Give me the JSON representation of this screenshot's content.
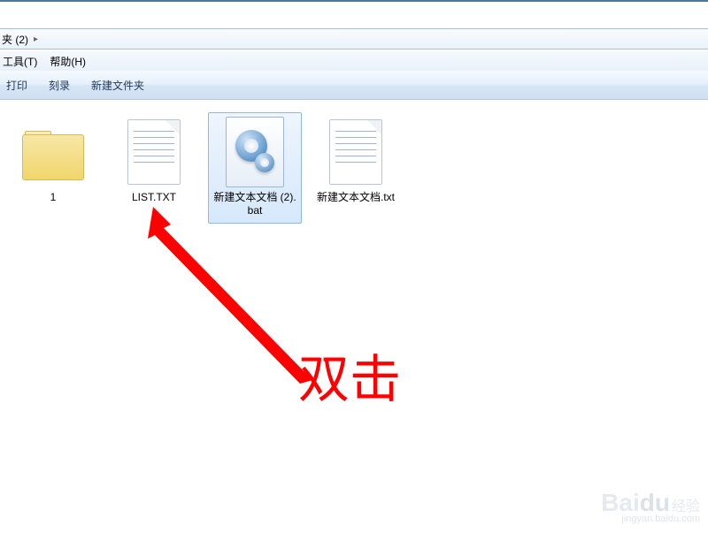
{
  "breadcrumb": {
    "path_fragment": "夹 (2)",
    "arrow": "▸"
  },
  "menubar": {
    "tools": "工具(T)",
    "help": "帮助(H)"
  },
  "toolbar": {
    "print": "打印",
    "burn": "刻录",
    "new_folder": "新建文件夹"
  },
  "items": [
    {
      "name": "1",
      "type": "folder",
      "selected": false
    },
    {
      "name": "LIST.TXT",
      "type": "txt",
      "selected": false
    },
    {
      "name": "新建文本文档 (2).bat",
      "type": "bat",
      "selected": true
    },
    {
      "name": "新建文本文档.txt",
      "type": "txt",
      "selected": false
    }
  ],
  "annotation": {
    "text": "双击"
  },
  "watermark": {
    "line1a": "Bai",
    "line1b": "du",
    "line1c": "经验",
    "line2": "jingyan.baidu.com"
  }
}
